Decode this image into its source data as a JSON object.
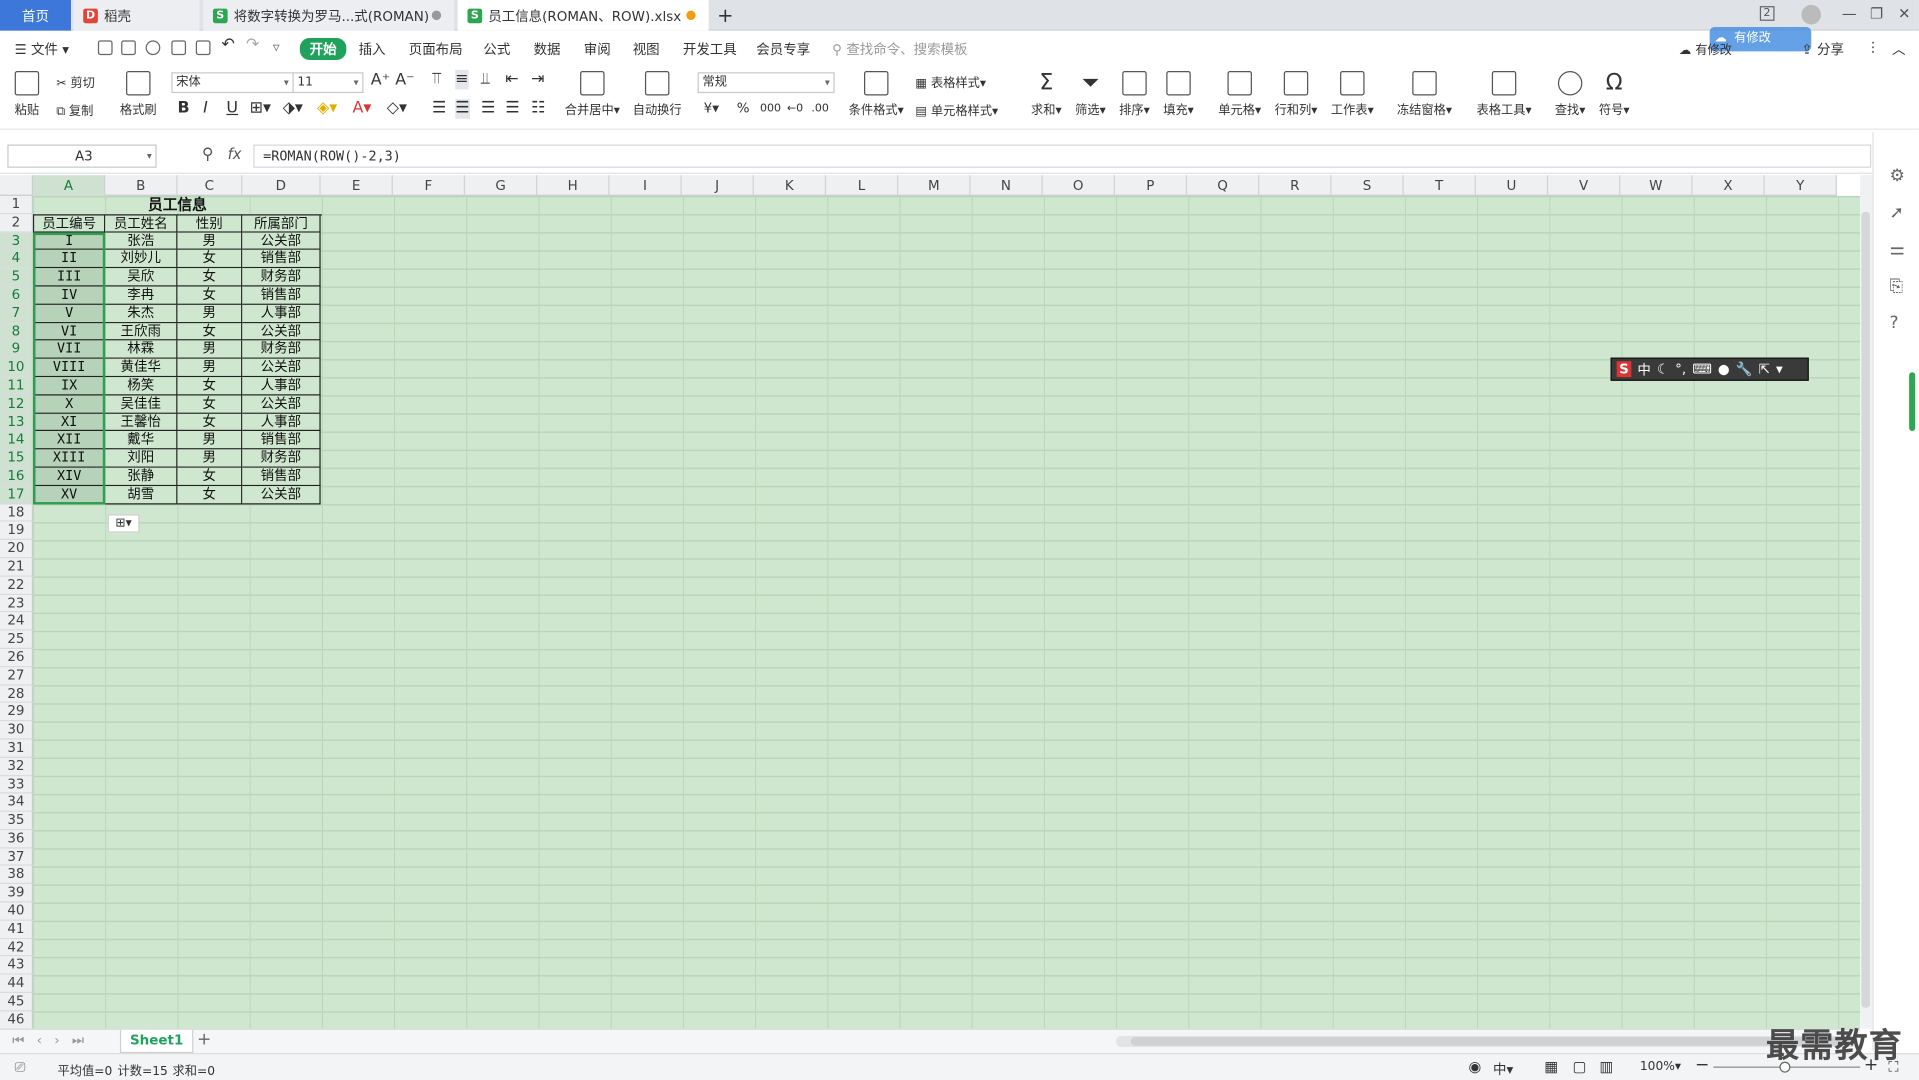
{
  "tabs": {
    "home": "首页",
    "docer": "稻壳",
    "file1": "将数字转换为罗马...式(ROMAN)",
    "file2": "员工信息(ROMAN、ROW).xlsx",
    "new": "+"
  },
  "window": {
    "num": "2",
    "min": "—",
    "max": "❐",
    "close": "✕"
  },
  "menu": {
    "file": "文件",
    "start": "开始",
    "insert": "插入",
    "layout": "页面布局",
    "formula": "公式",
    "data": "数据",
    "review": "审阅",
    "view": "视图",
    "dev": "开发工具",
    "member": "会员专享",
    "search": "查找命令、搜索模板",
    "status": "有修改",
    "share": "分享",
    "cloud": "有修改"
  },
  "ribbon": {
    "paste": "粘贴",
    "cut": "剪切",
    "copy": "复制",
    "format_painter": "格式刷",
    "font": "宋体",
    "size": "11",
    "bold": "B",
    "italic": "I",
    "underline": "U",
    "merge": "合并居中",
    "wrap": "自动换行",
    "numfmt": "常规",
    "cond": "条件格式",
    "table_style": "表格样式",
    "cell_style": "单元格样式",
    "sum": "求和",
    "filter": "筛选",
    "sort": "排序",
    "fill": "填充",
    "cell": "单元格",
    "rowcol": "行和列",
    "sheet": "工作表",
    "freeze": "冻结窗格",
    "tabletool": "表格工具",
    "find": "查找",
    "symbol": "符号",
    "percent": "%",
    "thousand": "000",
    "yen": "¥"
  },
  "formula_bar": {
    "namebox": "A3",
    "fx": "fx",
    "formula": "=ROMAN(ROW()-2,3)"
  },
  "columns": [
    "A",
    "B",
    "C",
    "D",
    "E",
    "F",
    "G",
    "H",
    "I",
    "J",
    "K",
    "L",
    "M",
    "N",
    "O",
    "P",
    "Q",
    "R",
    "S",
    "T",
    "U",
    "V",
    "W",
    "X",
    "Y"
  ],
  "rows": [
    "1",
    "2",
    "3",
    "4",
    "5",
    "6",
    "7",
    "8",
    "9",
    "10",
    "11",
    "12",
    "13",
    "14",
    "15",
    "16",
    "17",
    "18",
    "19",
    "20",
    "21",
    "22",
    "23",
    "24",
    "25",
    "26",
    "27",
    "28",
    "29",
    "30",
    "31",
    "32",
    "33",
    "34",
    "35",
    "36",
    "37",
    "38",
    "39",
    "40",
    "41",
    "42",
    "43",
    "44",
    "45",
    "46"
  ],
  "sheet": {
    "title": "员工信息",
    "headers": [
      "员工编号",
      "员工姓名",
      "性别",
      "所属部门"
    ],
    "rows": [
      [
        "I",
        "张浩",
        "男",
        "公关部"
      ],
      [
        "II",
        "刘妙儿",
        "女",
        "销售部"
      ],
      [
        "III",
        "吴欣",
        "女",
        "财务部"
      ],
      [
        "IV",
        "李冉",
        "女",
        "销售部"
      ],
      [
        "V",
        "朱杰",
        "男",
        "人事部"
      ],
      [
        "VI",
        "王欣雨",
        "女",
        "公关部"
      ],
      [
        "VII",
        "林霖",
        "男",
        "财务部"
      ],
      [
        "VIII",
        "黄佳华",
        "男",
        "公关部"
      ],
      [
        "IX",
        "杨笑",
        "女",
        "人事部"
      ],
      [
        "X",
        "吴佳佳",
        "女",
        "公关部"
      ],
      [
        "XI",
        "王馨怡",
        "女",
        "人事部"
      ],
      [
        "XII",
        "戴华",
        "男",
        "销售部"
      ],
      [
        "XIII",
        "刘阳",
        "男",
        "财务部"
      ],
      [
        "XIV",
        "张静",
        "女",
        "销售部"
      ],
      [
        "XV",
        "胡雪",
        "女",
        "公关部"
      ]
    ]
  },
  "sheetbar": {
    "tab": "Sheet1",
    "add": "+"
  },
  "status": {
    "avg": "平均值=0",
    "count": "计数=15",
    "sum": "求和=0",
    "zoom": "100%",
    "lang": "中"
  },
  "ime": {
    "label": "中"
  },
  "watermark": "最需教育"
}
